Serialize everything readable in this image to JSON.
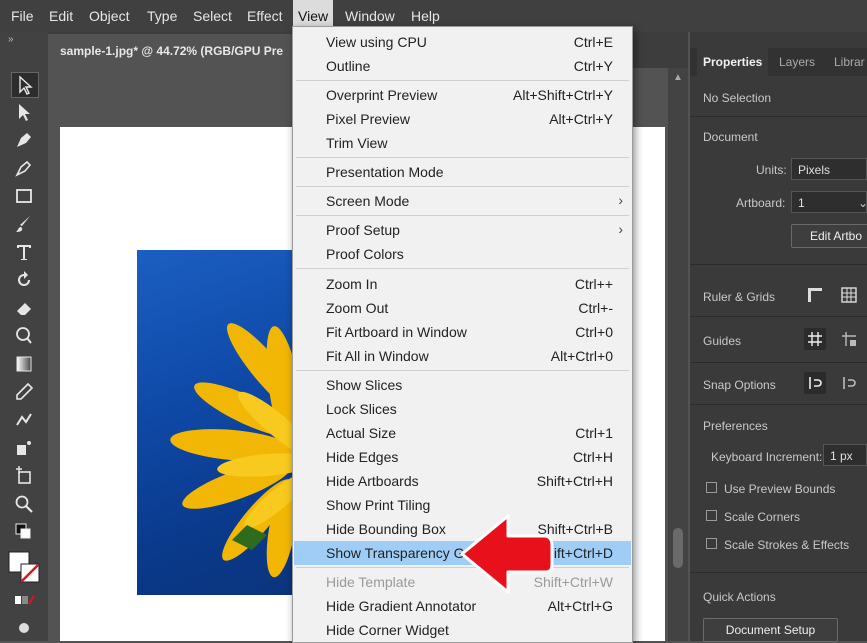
{
  "menubar": {
    "items": [
      "File",
      "Edit",
      "Object",
      "Type",
      "Select",
      "Effect",
      "View",
      "Window",
      "Help"
    ],
    "active_index": 6
  },
  "document": {
    "tab_title": "sample-1.jpg* @ 44.72% (RGB/GPU Pre"
  },
  "toolbar": {
    "collapse": "»",
    "tools": [
      "selection-tool-icon",
      "direct-selection-tool-icon",
      "pen-tool-icon",
      "curvature-tool-icon",
      "rectangle-tool-icon",
      "paintbrush-tool-icon",
      "type-tool-icon",
      "rotate-tool-icon",
      "eraser-tool-icon",
      "lasso-tool-icon",
      "gradient-tool-icon",
      "eyedropper-tool-icon",
      "blend-tool-icon",
      "symbol-sprayer-tool-icon",
      "artboard-tool-icon",
      "zoom-tool-icon"
    ]
  },
  "view_menu": {
    "items": [
      {
        "label": "View using CPU",
        "shortcut": "Ctrl+E"
      },
      {
        "label": "Outline",
        "shortcut": "Ctrl+Y"
      },
      {
        "label": "Overprint Preview",
        "shortcut": "Alt+Shift+Ctrl+Y"
      },
      {
        "label": "Pixel Preview",
        "shortcut": "Alt+Ctrl+Y"
      },
      {
        "label": "Trim View",
        "shortcut": ""
      },
      {
        "label": "Presentation Mode",
        "shortcut": ""
      },
      {
        "label": "Screen Mode",
        "shortcut": "",
        "submenu": "›"
      },
      {
        "label": "Proof Setup",
        "shortcut": "",
        "submenu": "›"
      },
      {
        "label": "Proof Colors",
        "shortcut": ""
      },
      {
        "label": "Zoom In",
        "shortcut": "Ctrl++"
      },
      {
        "label": "Zoom Out",
        "shortcut": "Ctrl+-"
      },
      {
        "label": "Fit Artboard in Window",
        "shortcut": "Ctrl+0"
      },
      {
        "label": "Fit All in Window",
        "shortcut": "Alt+Ctrl+0"
      },
      {
        "label": "Show Slices",
        "shortcut": ""
      },
      {
        "label": "Lock Slices",
        "shortcut": ""
      },
      {
        "label": "Actual Size",
        "shortcut": "Ctrl+1"
      },
      {
        "label": "Hide Edges",
        "shortcut": "Ctrl+H"
      },
      {
        "label": "Hide Artboards",
        "shortcut": "Shift+Ctrl+H"
      },
      {
        "label": "Show Print Tiling",
        "shortcut": ""
      },
      {
        "label": "Hide Bounding Box",
        "shortcut": "Shift+Ctrl+B"
      },
      {
        "label": "Show Transparency Grid",
        "shortcut": "Shift+Ctrl+D",
        "highlighted": true
      },
      {
        "label": "Hide Template",
        "shortcut": "Shift+Ctrl+W",
        "disabled": true
      },
      {
        "label": "Hide Gradient Annotator",
        "shortcut": "Alt+Ctrl+G"
      },
      {
        "label": "Hide Corner Widget",
        "shortcut": ""
      }
    ]
  },
  "panel": {
    "tabs": [
      "Properties",
      "Layers",
      "Librar"
    ],
    "no_selection": "No Selection",
    "document_heading": "Document",
    "units_label": "Units:",
    "units_value": "Pixels",
    "artboard_label": "Artboard:",
    "artboard_value": "1",
    "edit_artboards": "Edit Artbo",
    "rulers_grids": "Ruler & Grids",
    "guides": "Guides",
    "snap_options": "Snap Options",
    "preferences": "Preferences",
    "keyboard_increment_label": "Keyboard Increment:",
    "keyboard_increment_value": "1 px",
    "use_preview_bounds": "Use Preview Bounds",
    "scale_corners": "Scale Corners",
    "scale_strokes_effects": "Scale Strokes & Effects",
    "quick_actions": "Quick Actions",
    "document_setup": "Document Setup"
  },
  "colors": {
    "highlight": "#9fcdf6",
    "arrow": "#e8101a",
    "menubar": "#404040"
  }
}
